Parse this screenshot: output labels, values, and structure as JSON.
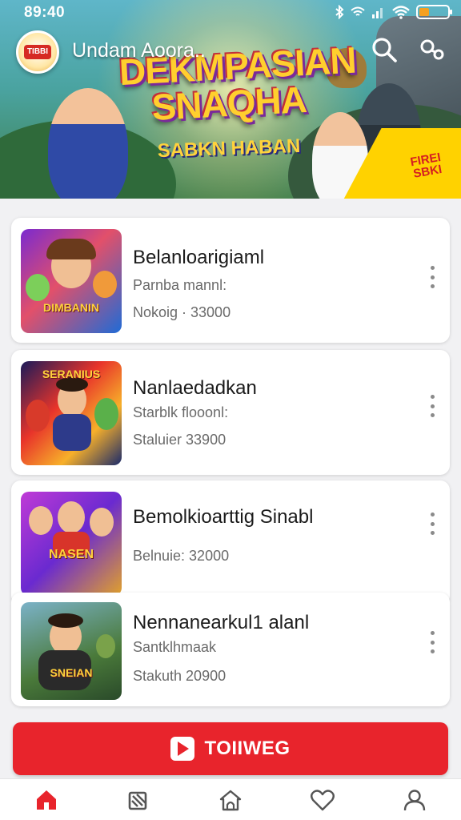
{
  "status_bar": {
    "time": "89:40"
  },
  "header": {
    "app_title": "Undam Aoora..",
    "logo_text": "TIBBI",
    "icons": [
      "search-icon",
      "share-icon"
    ]
  },
  "banner": {
    "title_line1": "DEKMPASIAN",
    "title_line2": "SNAQHA",
    "subtitle": "SABKN HABAN",
    "promo_flag": "FIREI SBKI"
  },
  "games": [
    {
      "title": "Belanloarigiaml",
      "line1": "Parnba mannl:",
      "line2": "Nokoig · 33000",
      "thumb_text": "DIMBANIN"
    },
    {
      "title": "Nanlaedadkan",
      "line1": "Starblk flooonl:",
      "line2": "Staluier 33900",
      "thumb_text": "SERANIUS"
    },
    {
      "title": "Bemolkioarttig Sinabl",
      "line1": "",
      "line2": "Belnuie: 32000",
      "thumb_text": "NASEN"
    },
    {
      "title": "Nennanearkul1 alanl",
      "line1": "Santklhmaak",
      "line2": "Stakuth 20900",
      "thumb_text": "SNEIAN"
    }
  ],
  "cta": {
    "label": "TOIIWEG"
  },
  "bottom_nav": [
    "home-icon",
    "library-icon",
    "store-icon",
    "favorites-icon",
    "profile-icon"
  ],
  "colors": {
    "accent": "#e8242c",
    "active_nav": "#e8242c",
    "inactive_nav": "#555555"
  }
}
